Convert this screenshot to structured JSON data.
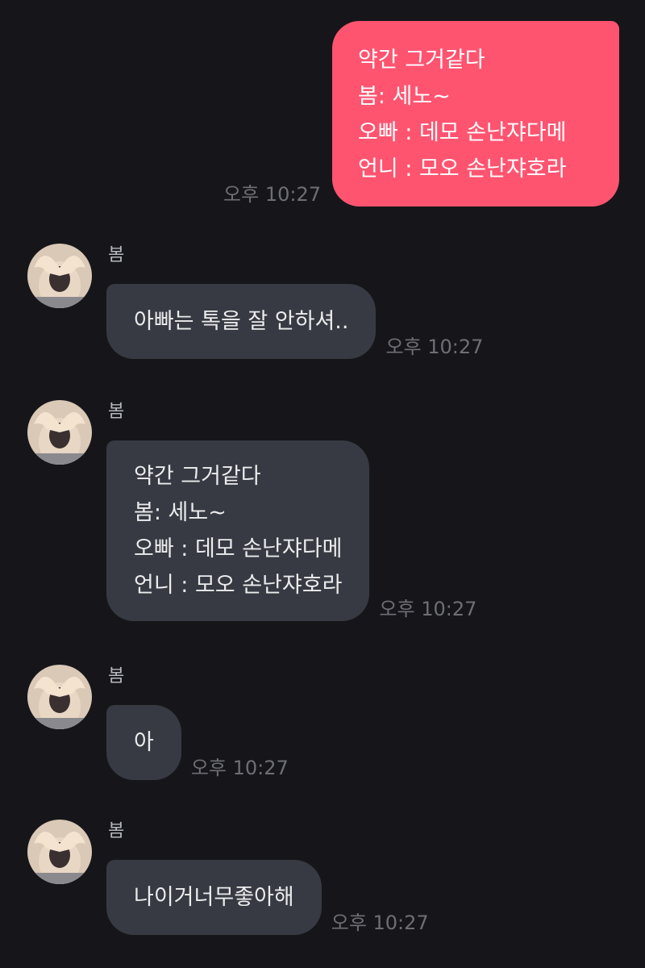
{
  "messages": {
    "outgoing": {
      "lines": [
        "약간 그거같다",
        "봄: 세노~",
        "오빠 : 데모 손난쟈다메",
        "언니 : 모오 손난쟈호라"
      ],
      "time": "오후 10:27"
    },
    "incoming": [
      {
        "sender": "봄",
        "lines": [
          "아빠는 톡을 잘 안하셔.."
        ],
        "time": "오후 10:27"
      },
      {
        "sender": "봄",
        "lines": [
          "약간 그거같다",
          "봄: 세노~",
          "오빠 : 데모 손난쟈다메",
          "언니 : 모오 손난쟈호라"
        ],
        "time": "오후 10:27"
      },
      {
        "sender": "봄",
        "lines": [
          "아"
        ],
        "time": "오후 10:27"
      },
      {
        "sender": "봄",
        "lines": [
          "나이거너무좋아해"
        ],
        "time": "오후 10:27"
      }
    ]
  },
  "colors": {
    "background": "#16161a",
    "outgoing_bubble": "#ff5470",
    "incoming_bubble": "#373a42",
    "timestamp": "#6e6f74"
  },
  "icons": {
    "avatar": "profile-photo-heart-hands"
  }
}
